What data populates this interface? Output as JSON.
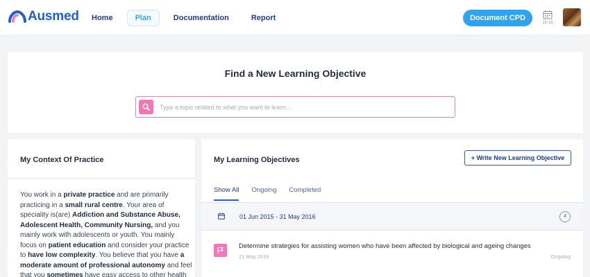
{
  "header": {
    "brand": "Ausmed",
    "nav": [
      {
        "label": "Home",
        "active": false
      },
      {
        "label": "Plan",
        "active": true
      },
      {
        "label": "Documentation",
        "active": false
      },
      {
        "label": "Report",
        "active": false
      }
    ],
    "cpd_button": "Document CPD",
    "calendar_label": "15-16",
    "accent_color": "#2ea4f0"
  },
  "search": {
    "title": "Find a New Learning Objective",
    "placeholder": "Type a topic related to what you want to learn..."
  },
  "context": {
    "title": "My Context Of Practice",
    "paragraph": [
      {
        "text": "You work in a ",
        "bold": false
      },
      {
        "text": "private practice",
        "bold": true
      },
      {
        "text": " and are primarily practicing in a ",
        "bold": false
      },
      {
        "text": "small rural centre",
        "bold": true
      },
      {
        "text": ". Your area of speciality is(are) ",
        "bold": false
      },
      {
        "text": "Addiction and Substance Abuse, Adolescent Health, Community Nursing,",
        "bold": true
      },
      {
        "text": " and you mainly work with adolescents or youth. You mainly focus on ",
        "bold": false
      },
      {
        "text": "patient education",
        "bold": true
      },
      {
        "text": " and consider your practice to ",
        "bold": false
      },
      {
        "text": "have low complexity",
        "bold": true
      },
      {
        "text": ". You believe that you have ",
        "bold": false
      },
      {
        "text": "a moderate amount of professional autonomy",
        "bold": true
      },
      {
        "text": " and feel that you ",
        "bold": false
      },
      {
        "text": "sometimes",
        "bold": true
      },
      {
        "text": " have easy access to other health",
        "bold": false
      }
    ]
  },
  "objectives": {
    "title": "My Learning Objectives",
    "write_button": "+ Write New Learning Objective",
    "tabs": [
      {
        "label": "Show All",
        "active": true
      },
      {
        "label": "Ongoing",
        "active": false
      },
      {
        "label": "Completed",
        "active": false
      }
    ],
    "period": {
      "label": "01 Jun 2015 - 31 May 2016",
      "count": "4"
    },
    "items": [
      {
        "title": "Determine strategies for assisting women who have been affected by biological and ageing changes",
        "date": "21 May 2016",
        "status": "Ongoing"
      }
    ],
    "pink": "#f277b7"
  }
}
